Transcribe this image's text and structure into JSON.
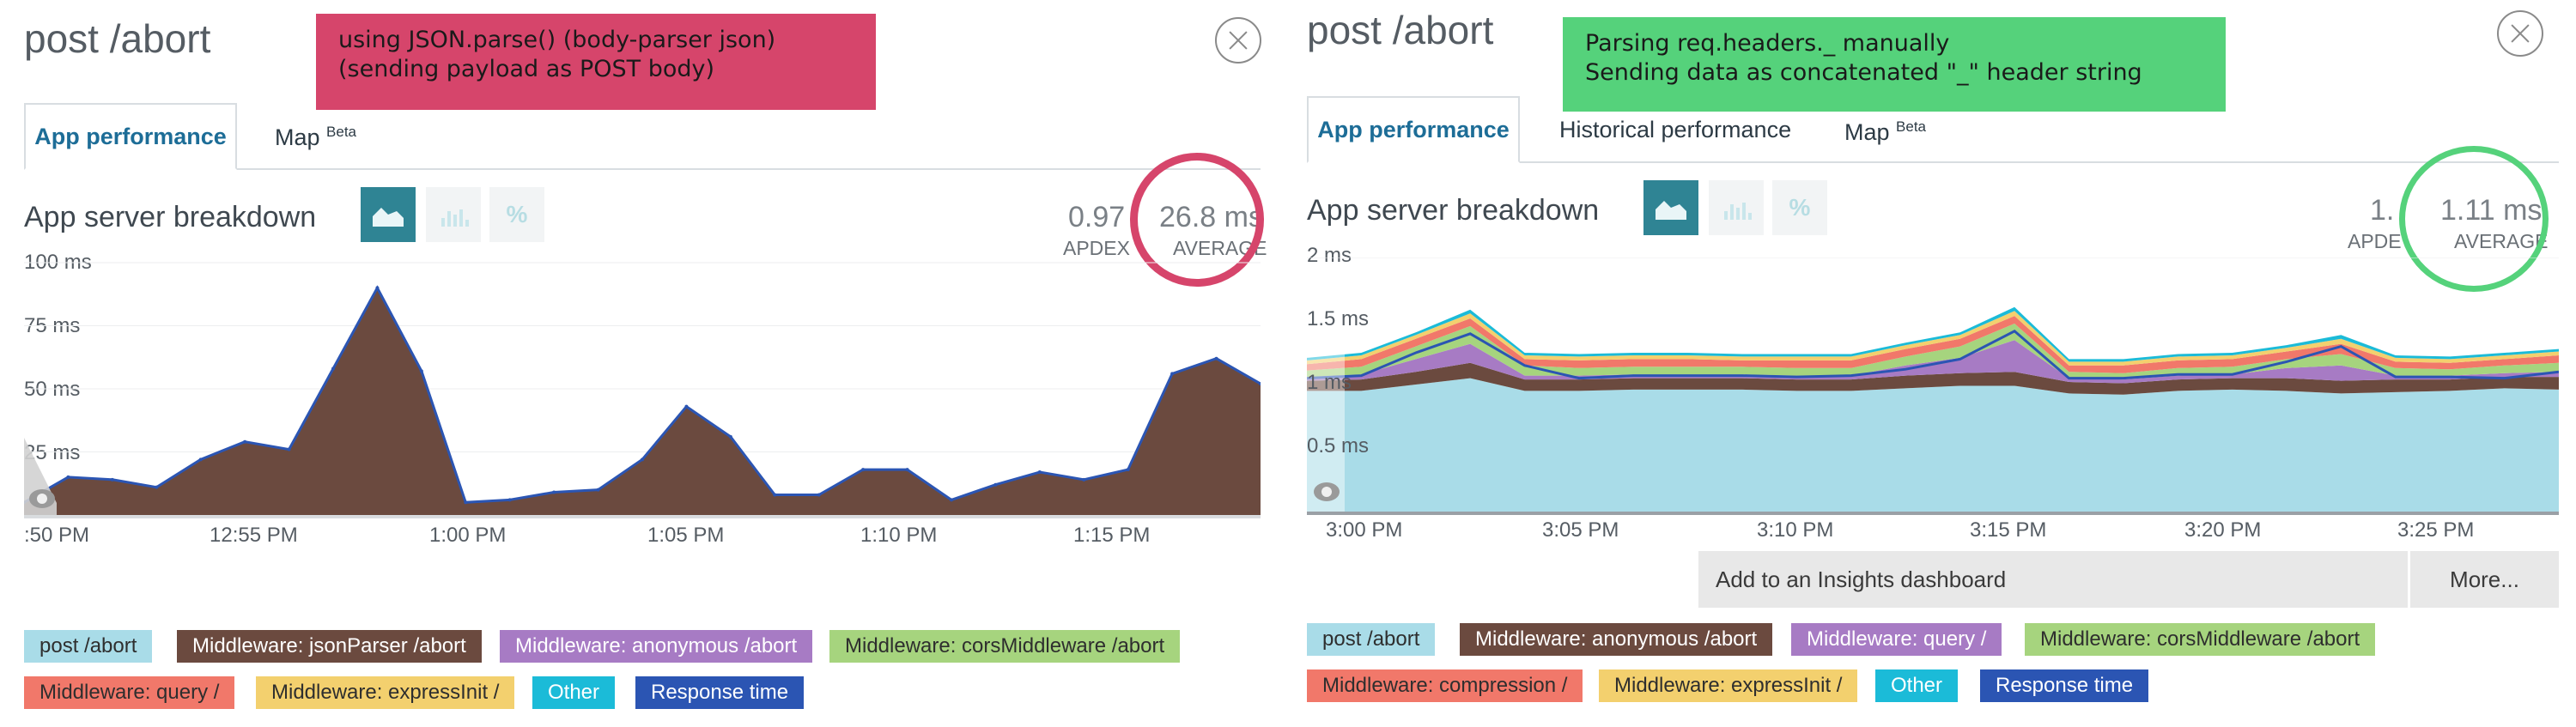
{
  "left": {
    "title": "post /abort",
    "annotation": {
      "lines": [
        "using JSON.parse() (body-parser json)",
        "(sending payload as POST body)"
      ],
      "color": "#d6456b"
    },
    "tabs": [
      {
        "label": "App performance",
        "sup": ""
      },
      {
        "label": "Map ",
        "sup": "Beta"
      }
    ],
    "section_title": "App server breakdown",
    "apdex_value": "0.97",
    "apdex_label": "APDEX",
    "average_value": "26.8 ms",
    "average_label": "AVERAGE",
    "highlight_ring_color": "#d6456b",
    "chart_data": {
      "type": "area",
      "y_unit": "ms",
      "ylim": [
        0,
        100
      ],
      "y_ticks": [
        "100 ms",
        "75 ms",
        "50 ms",
        "25 ms"
      ],
      "x_ticks": [
        ":50 PM",
        "12:55 PM",
        "1:00 PM",
        "1:05 PM",
        "1:10 PM",
        "1:15 PM"
      ],
      "series": [
        {
          "name": "Middleware: jsonParser /abort",
          "color": "#6b4a3f",
          "values": [
            5,
            15,
            14,
            11,
            22,
            29,
            26,
            58,
            90,
            57,
            5,
            6,
            9,
            10,
            22,
            43,
            31,
            8,
            8,
            18,
            18,
            6,
            12,
            17,
            14,
            18,
            56,
            62,
            52
          ]
        },
        {
          "name": "Response time",
          "color": "#2b55b3",
          "values": [
            5,
            15,
            14,
            11,
            22,
            29,
            26,
            58,
            90,
            57,
            5,
            6,
            9,
            10,
            22,
            43,
            31,
            8,
            8,
            18,
            18,
            6,
            12,
            17,
            14,
            18,
            56,
            62,
            52
          ]
        }
      ]
    },
    "legend": [
      {
        "label": "post /abort",
        "color": "#a9dce8"
      },
      {
        "label": "Middleware: jsonParser /abort",
        "color": "#6b4a3f"
      },
      {
        "label": "Middleware: anonymous /abort",
        "color": "#a77bc4"
      },
      {
        "label": "Middleware: corsMiddleware /abort",
        "color": "#a6d47e"
      },
      {
        "label": "Middleware: query /",
        "color": "#f1786a"
      },
      {
        "label": "Middleware: expressInit /",
        "color": "#f3d06e"
      },
      {
        "label": "Other",
        "color": "#1bbbd8"
      },
      {
        "label": "Response time",
        "color": "#2b55b3"
      }
    ]
  },
  "right": {
    "title": "post /abort",
    "annotation": {
      "lines": [
        "Parsing req.headers._ manually",
        "Sending data as concatenated \"_\" header string"
      ],
      "color": "#55d27b"
    },
    "tabs": [
      {
        "label": "App performance",
        "sup": ""
      },
      {
        "label": "Historical performance",
        "sup": ""
      },
      {
        "label": "Map ",
        "sup": "Beta"
      }
    ],
    "section_title": "App server breakdown",
    "apdex_value": "1.",
    "apdex_label": "APDE",
    "average_value": "1.11 ms",
    "average_label": "AVERAGE",
    "highlight_ring_color": "#55d27b",
    "chart_data": {
      "type": "area",
      "stacked": true,
      "y_unit": "ms",
      "ylim": [
        0,
        2
      ],
      "y_ticks": [
        "2 ms",
        "1.5 ms",
        "1 ms",
        "0.5 ms"
      ],
      "x_ticks": [
        "3:00 PM",
        "3:05 PM",
        "3:10 PM",
        "3:15 PM",
        "3:20 PM",
        "3:25 PM"
      ],
      "series": [
        {
          "name": "post /abort",
          "color": "#a9dce8",
          "values": [
            0.95,
            0.95,
            1.0,
            1.05,
            0.95,
            0.95,
            0.96,
            0.96,
            0.96,
            0.95,
            0.95,
            0.97,
            0.99,
            0.99,
            0.93,
            0.92,
            0.95,
            0.96,
            0.95,
            0.93,
            0.94,
            0.95,
            0.97,
            0.96
          ]
        },
        {
          "name": "Middleware: anonymous /abort",
          "color": "#6b4a3f",
          "values": [
            0.08,
            0.09,
            0.1,
            0.12,
            0.09,
            0.09,
            0.09,
            0.09,
            0.09,
            0.09,
            0.09,
            0.1,
            0.1,
            0.11,
            0.09,
            0.09,
            0.09,
            0.09,
            0.1,
            0.1,
            0.1,
            0.09,
            0.09,
            0.1
          ]
        },
        {
          "name": "Middleware: query /",
          "color": "#a77bc4",
          "values": [
            0.03,
            0.04,
            0.1,
            0.15,
            0.03,
            0.03,
            0.03,
            0.03,
            0.03,
            0.03,
            0.03,
            0.08,
            0.12,
            0.25,
            0.03,
            0.03,
            0.03,
            0.03,
            0.08,
            0.12,
            0.03,
            0.03,
            0.03,
            0.04
          ]
        },
        {
          "name": "Middleware: corsMiddleware /abort",
          "color": "#a6d47e",
          "values": [
            0.05,
            0.06,
            0.1,
            0.14,
            0.08,
            0.06,
            0.06,
            0.06,
            0.06,
            0.06,
            0.06,
            0.07,
            0.09,
            0.13,
            0.05,
            0.05,
            0.06,
            0.06,
            0.07,
            0.09,
            0.06,
            0.05,
            0.06,
            0.07
          ]
        },
        {
          "name": "Middleware: compression /",
          "color": "#f1786a",
          "values": [
            0.05,
            0.06,
            0.06,
            0.06,
            0.05,
            0.06,
            0.06,
            0.06,
            0.05,
            0.06,
            0.06,
            0.06,
            0.06,
            0.06,
            0.05,
            0.06,
            0.06,
            0.06,
            0.06,
            0.08,
            0.05,
            0.05,
            0.05,
            0.06
          ]
        },
        {
          "name": "Middleware: expressInit /",
          "color": "#f3d06e",
          "values": [
            0.03,
            0.03,
            0.03,
            0.04,
            0.03,
            0.03,
            0.03,
            0.03,
            0.03,
            0.03,
            0.03,
            0.03,
            0.03,
            0.04,
            0.03,
            0.03,
            0.03,
            0.03,
            0.03,
            0.04,
            0.03,
            0.03,
            0.03,
            0.03
          ]
        },
        {
          "name": "Other",
          "color": "#1bbbd8",
          "values": [
            0.02,
            0.02,
            0.02,
            0.03,
            0.02,
            0.02,
            0.02,
            0.02,
            0.02,
            0.02,
            0.02,
            0.02,
            0.02,
            0.03,
            0.02,
            0.02,
            0.02,
            0.02,
            0.02,
            0.03,
            0.02,
            0.02,
            0.02,
            0.02
          ]
        },
        {
          "name": "Response time",
          "color": "#2b55b3",
          "line_only": true,
          "values": [
            1.05,
            1.07,
            1.25,
            1.4,
            1.15,
            1.05,
            1.07,
            1.07,
            1.07,
            1.06,
            1.07,
            1.12,
            1.2,
            1.42,
            1.05,
            1.05,
            1.08,
            1.08,
            1.18,
            1.3,
            1.06,
            1.06,
            1.05,
            1.1
          ]
        }
      ]
    },
    "insights": {
      "add_label": "Add to an Insights dashboard",
      "more_label": "More..."
    },
    "legend": [
      {
        "label": "post /abort",
        "color": "#a9dce8"
      },
      {
        "label": "Middleware: anonymous /abort",
        "color": "#6b4a3f"
      },
      {
        "label": "Middleware: query /",
        "color": "#a77bc4"
      },
      {
        "label": "Middleware: corsMiddleware /abort",
        "color": "#a6d47e"
      },
      {
        "label": "Middleware: compression /",
        "color": "#f1786a"
      },
      {
        "label": "Middleware: expressInit /",
        "color": "#f3d06e"
      },
      {
        "label": "Other",
        "color": "#1bbbd8"
      },
      {
        "label": "Response time",
        "color": "#2b55b3"
      }
    ]
  }
}
